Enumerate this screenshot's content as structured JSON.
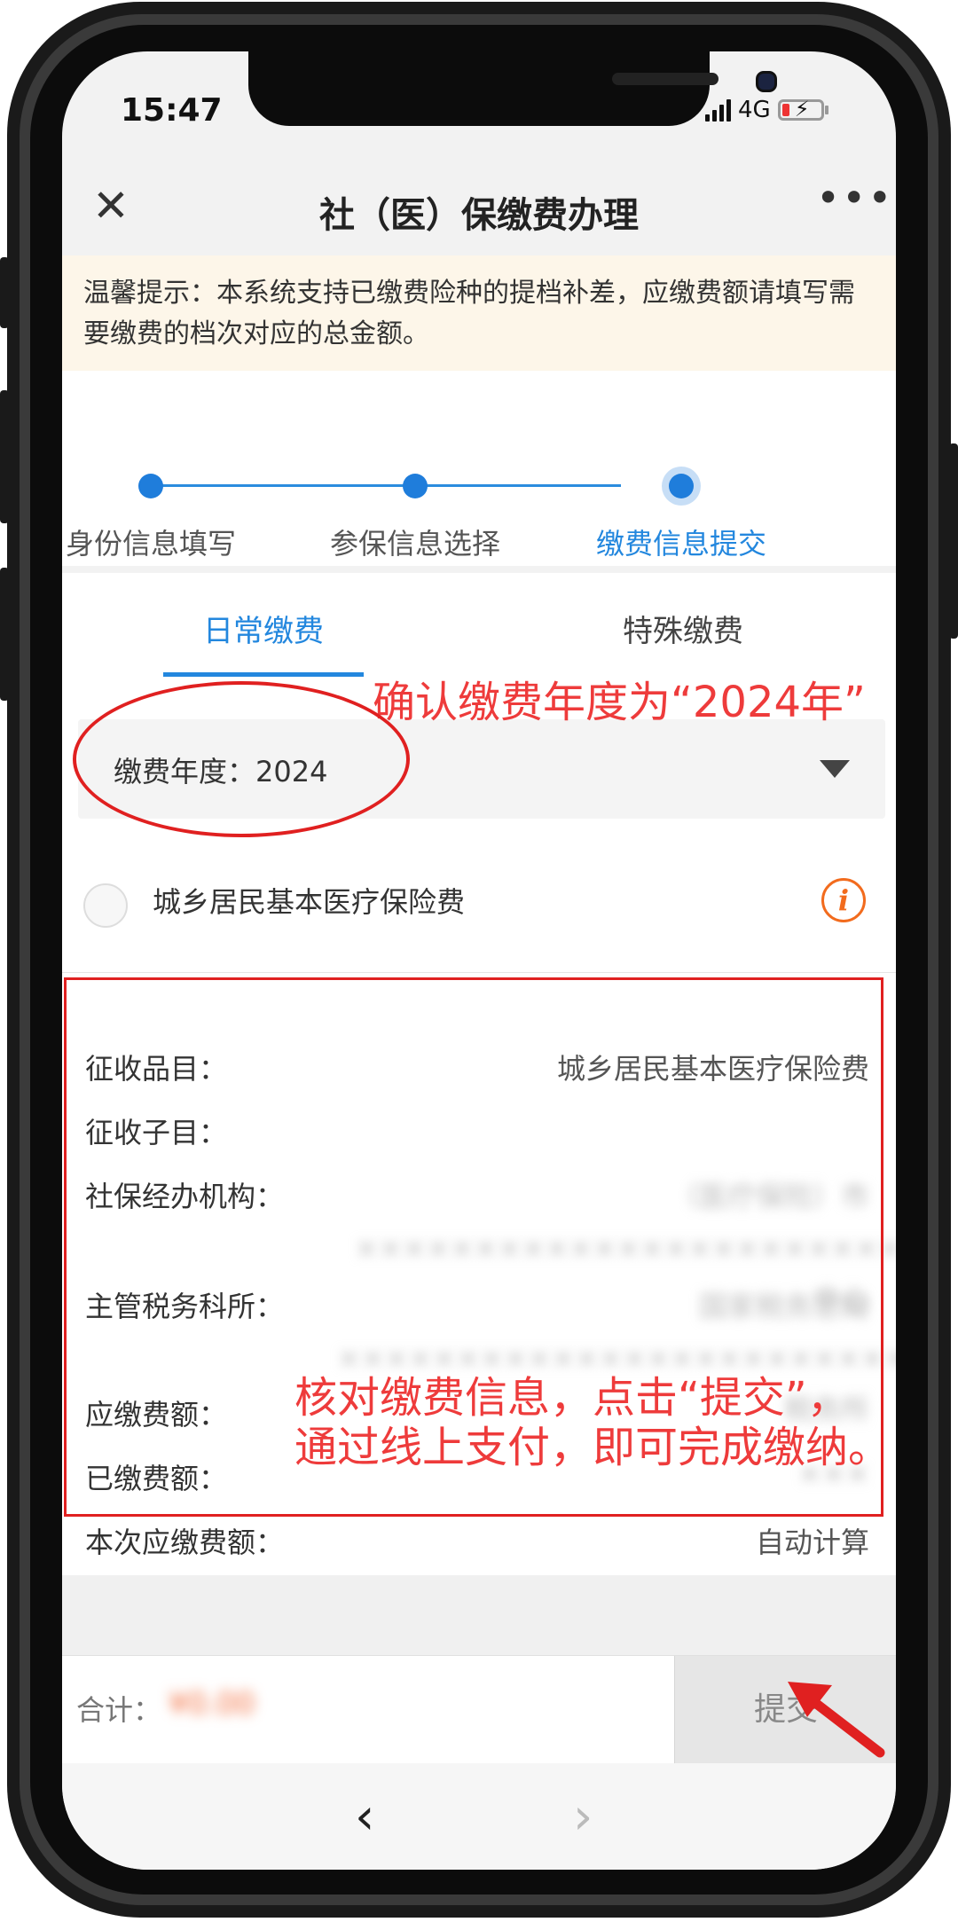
{
  "status_bar": {
    "time": "15:47",
    "network": "4G"
  },
  "header": {
    "title": "社（医）保缴费办理",
    "close_icon": "close-icon",
    "more_icon": "more-icon"
  },
  "notice": {
    "text": "温馨提示：本系统支持已缴费险种的提档补差，应缴费额请填写需要缴费的档次对应的总金额。"
  },
  "steps": [
    {
      "label": "身份信息填写",
      "state": "done"
    },
    {
      "label": "参保信息选择",
      "state": "done"
    },
    {
      "label": "缴费信息提交",
      "state": "current"
    }
  ],
  "tabs": [
    {
      "label": "日常缴费",
      "active": true
    },
    {
      "label": "特殊缴费",
      "active": false
    }
  ],
  "form": {
    "year_label": "缴费年度：",
    "year_value": "2024",
    "insurance_item": "城乡居民基本医疗保险费",
    "insurance_checked": false
  },
  "details": {
    "rows": [
      {
        "label": "征收品目：",
        "value": "城乡居民基本医疗保险费"
      },
      {
        "label": "征收子目：",
        "value": ""
      },
      {
        "label": "社保经办机构：",
        "value": "（医疗保险）市××××××××××××××××××××××××中心",
        "blurred": true
      },
      {
        "label": "主管税务科所：",
        "value": "国家税务总局×××××××××××××××××××××××××××税务所",
        "blurred": true
      },
      {
        "label": "应缴费额：",
        "value": ""
      },
      {
        "label": "已缴费额：",
        "value": "×××",
        "blurred": true
      },
      {
        "label": "本次应缴费额：",
        "value": "自动计算"
      }
    ]
  },
  "footer": {
    "total_label": "合计：",
    "total_value": "¥0.00",
    "submit_label": "提交"
  },
  "annotations": {
    "year_note": "确认缴费年度为“2024年”",
    "detail_note_line1": "核对缴费信息，点击“提交”，",
    "detail_note_line2": "通过线上支付，即可完成缴纳。"
  },
  "colors": {
    "accent": "#2387de",
    "annotation": "#e02020",
    "notice_bg": "#fdf6e9",
    "info": "#f26b1d"
  }
}
